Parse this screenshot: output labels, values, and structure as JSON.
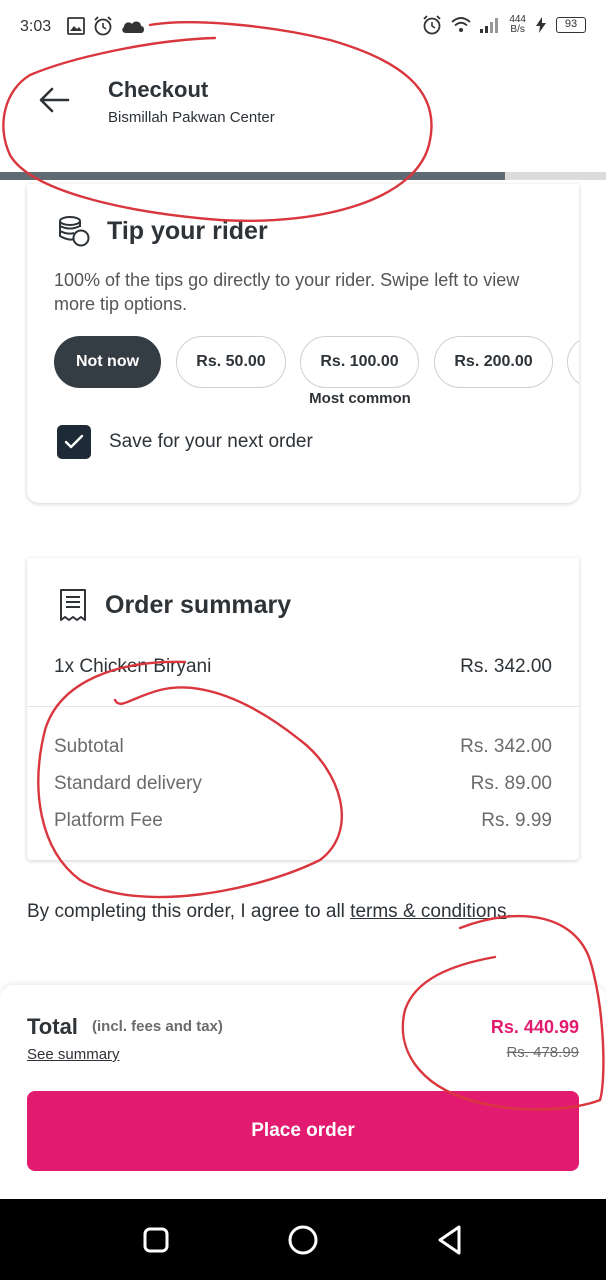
{
  "status_bar": {
    "time": "3:03",
    "speed_top": "444",
    "speed_bottom": "B/s",
    "battery": "93",
    "left_icons": [
      "gallery-icon",
      "alarm-icon",
      "cloud-icon"
    ],
    "right_icons": [
      "alarm-icon",
      "wifi-icon",
      "signal-icon",
      "charging-icon",
      "battery-icon"
    ]
  },
  "header": {
    "title": "Checkout",
    "subtitle": "Bismillah Pakwan Center",
    "progress": 0.833
  },
  "tip": {
    "title": "Tip your rider",
    "description": "100% of the tips go directly to your rider. Swipe left to view more tip options.",
    "options": [
      "Not now",
      "Rs. 50.00",
      "Rs. 100.00",
      "Rs. 200.00"
    ],
    "selected_index": 0,
    "most_common_label": "Most common",
    "save_label": "Save for your next order",
    "save_checked": true
  },
  "order_summary": {
    "title": "Order summary",
    "items": [
      {
        "name": "1x Chicken Biryani",
        "price": "Rs. 342.00"
      }
    ],
    "fees": [
      {
        "label": "Subtotal",
        "value": "Rs. 342.00"
      },
      {
        "label": "Standard delivery",
        "value": "Rs. 89.00"
      },
      {
        "label": "Platform Fee",
        "value": "Rs. 9.99"
      }
    ]
  },
  "terms": {
    "text": "By completing this order, I agree to all ",
    "link": "terms & conditions",
    "suffix": "."
  },
  "footer": {
    "total_label": "Total",
    "total_note": "(incl. fees and tax)",
    "see_summary": "See summary",
    "total_price": "Rs. 440.99",
    "old_price": "Rs. 478.99",
    "place_order": "Place order"
  },
  "colors": {
    "accent": "#e21b70",
    "dark": "#343c44",
    "annotation": "#d9363e"
  }
}
